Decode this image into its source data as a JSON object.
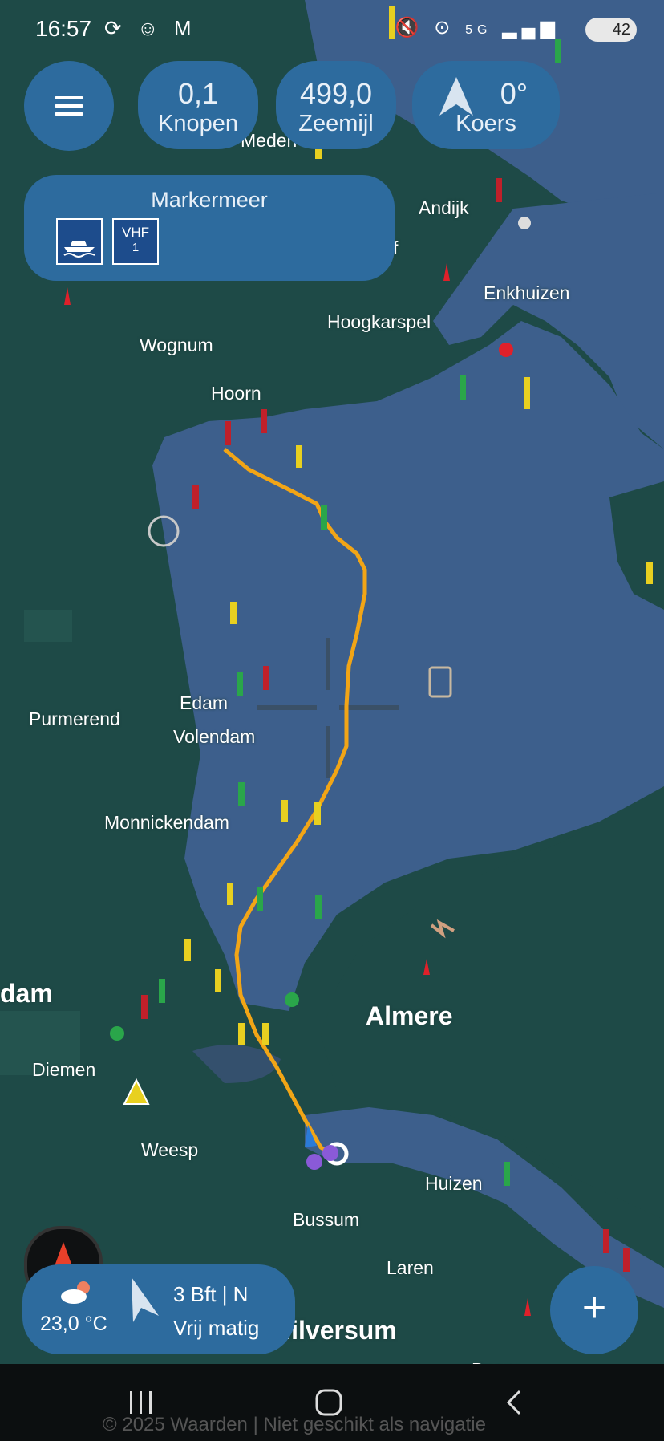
{
  "status_bar": {
    "time": "16:57",
    "battery": "42",
    "left_icons": [
      "sync-icon",
      "snapchat-icon",
      "gmail-icon"
    ],
    "right_icons": [
      "mute-icon",
      "location-icon",
      "5g-icon",
      "signal-icon"
    ],
    "network_label": "5G"
  },
  "stats": {
    "speed_value": "0,1",
    "speed_label": "Knopen",
    "distance_value": "499,0",
    "distance_label": "Zeemijl",
    "heading_value": "0°",
    "heading_label": "Koers"
  },
  "region": {
    "title": "Markermeer",
    "badges": [
      {
        "icon": "motorboat-icon"
      },
      {
        "icon": "vhf-icon",
        "label": "VHF",
        "channel": "1"
      }
    ]
  },
  "map": {
    "labels": [
      "Andijk",
      "Enkhuizen",
      "Hoogkarspel",
      "Wognum",
      "Hoorn",
      "Edam",
      "Volendam",
      "Purmerend",
      "Monnickendam",
      "Almere",
      "dam",
      "Diemen",
      "Weesp",
      "Huizen",
      "Bussum",
      "Laren",
      "Hilversum",
      "Baarn",
      "Meden",
      "f"
    ],
    "colors": {
      "land": "#1e4a47",
      "water": "#3d5f8c",
      "track": "#f2a516",
      "panel": "#2d6b9e"
    }
  },
  "weather": {
    "temperature": "23,0 °C",
    "wind_force": "3 Bft | N",
    "wind_desc": "Vrij matig"
  },
  "fab": {
    "label": "+"
  },
  "attribution": "© 2025 Waarden | Niet geschikt als navigatie"
}
